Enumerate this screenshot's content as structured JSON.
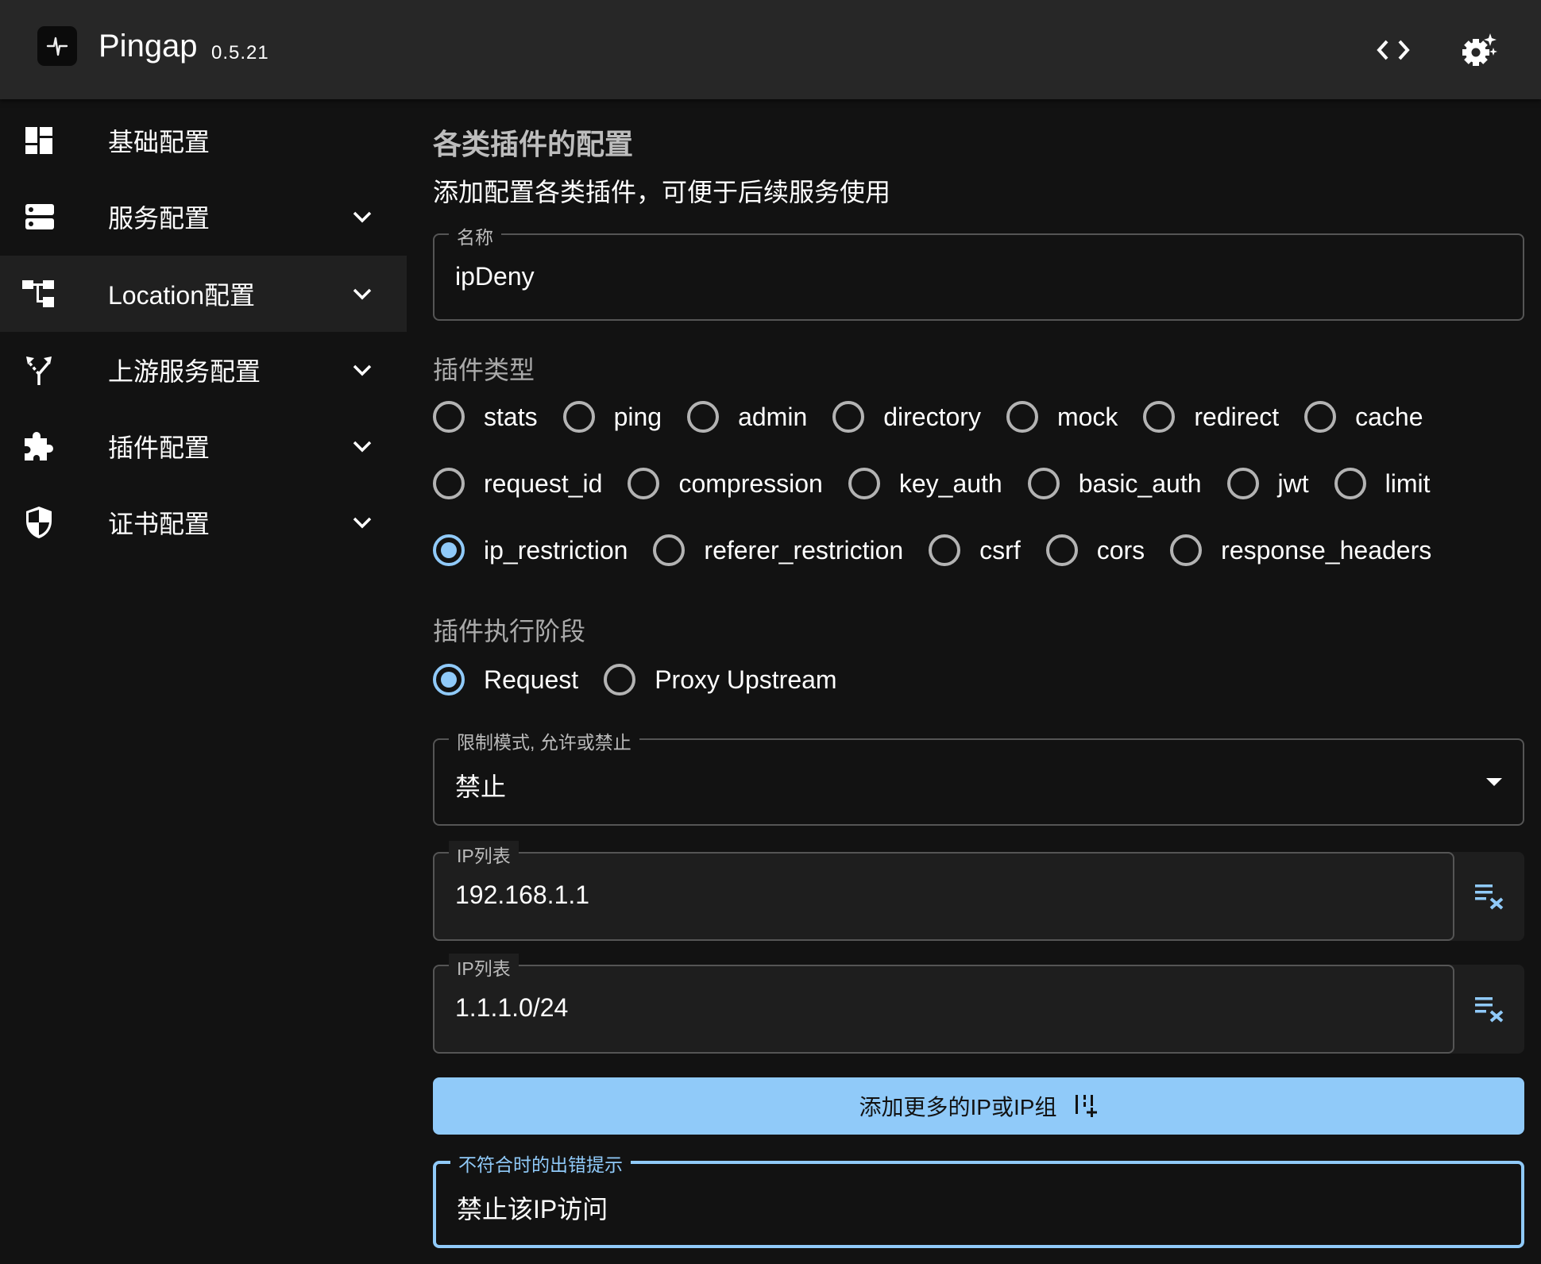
{
  "header": {
    "app_name": "Pingap",
    "version": "0.5.21",
    "logo_icon": "pulse-icon",
    "actions": [
      {
        "name": "code-view",
        "icon": "code-icon"
      },
      {
        "name": "settings",
        "icon": "settings-sparkle-icon"
      }
    ]
  },
  "sidebar": {
    "items": [
      {
        "label": "基础配置",
        "icon": "dashboard-icon",
        "expandable": false,
        "selected": false
      },
      {
        "label": "服务配置",
        "icon": "server-icon",
        "expandable": true,
        "selected": false
      },
      {
        "label": "Location配置",
        "icon": "account-tree-icon",
        "expandable": true,
        "selected": true
      },
      {
        "label": "上游服务配置",
        "icon": "fork-icon",
        "expandable": true,
        "selected": false
      },
      {
        "label": "插件配置",
        "icon": "puzzle-icon",
        "expandable": true,
        "selected": false
      },
      {
        "label": "证书配置",
        "icon": "shield-icon",
        "expandable": true,
        "selected": false
      }
    ]
  },
  "main": {
    "title": "各类插件的配置",
    "description": "添加配置各类插件，可便于后续服务使用",
    "name_field": {
      "label": "名称",
      "value": "ipDeny"
    },
    "plugin_type": {
      "label": "插件类型",
      "selected": "ip_restriction",
      "rows": [
        [
          "stats",
          "ping",
          "admin",
          "directory",
          "mock",
          "redirect",
          "cache"
        ],
        [
          "request_id",
          "compression",
          "key_auth",
          "basic_auth",
          "jwt",
          "limit"
        ],
        [
          "ip_restriction",
          "referer_restriction",
          "csrf",
          "cors",
          "response_headers"
        ]
      ]
    },
    "plugin_step": {
      "label": "插件执行阶段",
      "selected": "Request",
      "options": [
        "Request",
        "Proxy Upstream"
      ]
    },
    "mode_select": {
      "label": "限制模式, 允许或禁止",
      "value": "禁止"
    },
    "ip_list": {
      "label": "IP列表",
      "items": [
        "192.168.1.1",
        "1.1.1.0/24"
      ],
      "clear_icon": "playlist-remove-icon"
    },
    "add_button": {
      "label": "添加更多的IP或IP组",
      "icon": "playlist-add-icon"
    },
    "error_message_field": {
      "label": "不符合时的出错提示",
      "value": "禁止该IP访问"
    }
  },
  "colors": {
    "accent": "#90caf9",
    "background": "#121212",
    "header": "#272727",
    "selected_nav": "#202020"
  }
}
